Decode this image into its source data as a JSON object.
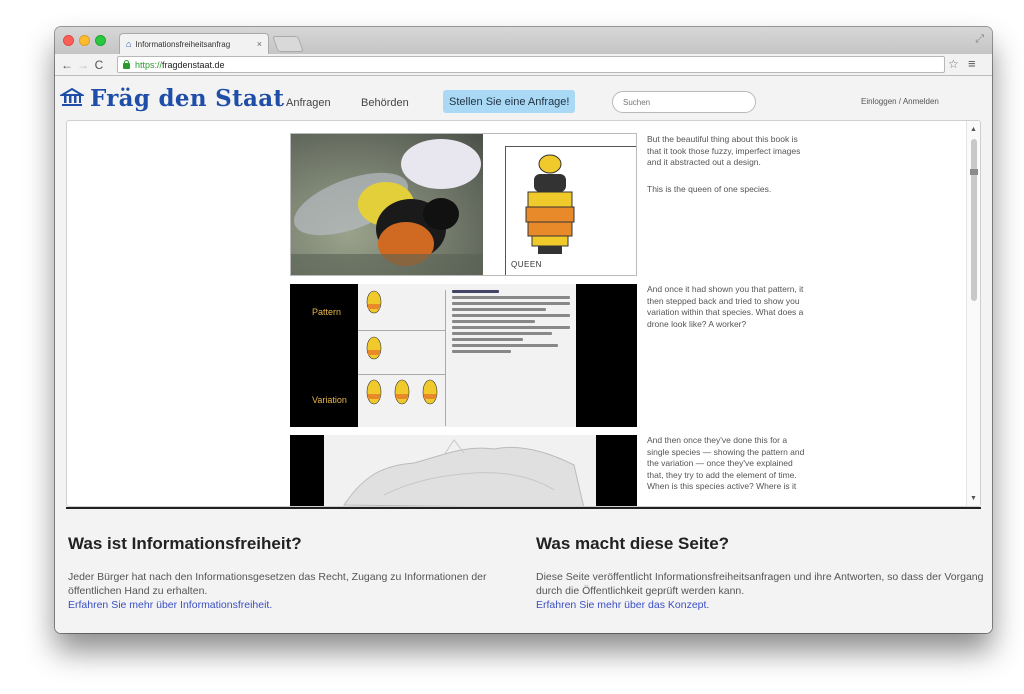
{
  "browser": {
    "tab_title": "Informationsfreiheitsanfrag",
    "tab_close": "×",
    "url_scheme": "https://",
    "url_host": "fragdenstaat.de"
  },
  "site": {
    "logo_text": "Fräg den Staat",
    "nav": [
      "Anfragen",
      "Behörden"
    ],
    "cta": "Stellen Sie eine Anfrage!",
    "search_placeholder": "Suchen",
    "login": "Einloggen / Anmelden"
  },
  "embed": {
    "captions": [
      "But the beautiful thing about this book is that it took those fuzzy, imperfect images and it abstracted out a design.",
      "This is the queen of one species.",
      "And once it had shown you that pattern, it then stepped back and tried to show you variation within that species. What does a drone look like? A worker?",
      "And then once they've done this for a single species — showing the pattern and the variation — once they've explained that, they try to add the element of time. When is this species active? Where is it"
    ],
    "panel1_label": "QUEEN",
    "panel2_labels": [
      "Pattern",
      "Variation"
    ]
  },
  "footer": {
    "left": {
      "title": "Was ist Informationsfreiheit?",
      "text": "Jeder Bürger hat nach den Informationsgesetzen das Recht, Zugang zu Informationen der öffentlichen Hand zu erhalten.",
      "link": "Erfahren Sie mehr über Informationsfreiheit."
    },
    "right": {
      "title": "Was macht diese Seite?",
      "text": "Diese Seite veröffentlicht Informationsfreiheitsanfragen und ihre Antworten, so dass der Vorgang durch die Öffentlichkeit geprüft werden kann.",
      "link": "Erfahren Sie mehr über das Konzept."
    }
  },
  "colors": {
    "brand": "#1f4ea8",
    "cta_bg": "#a9d9f5",
    "link": "#3a4fc4"
  }
}
